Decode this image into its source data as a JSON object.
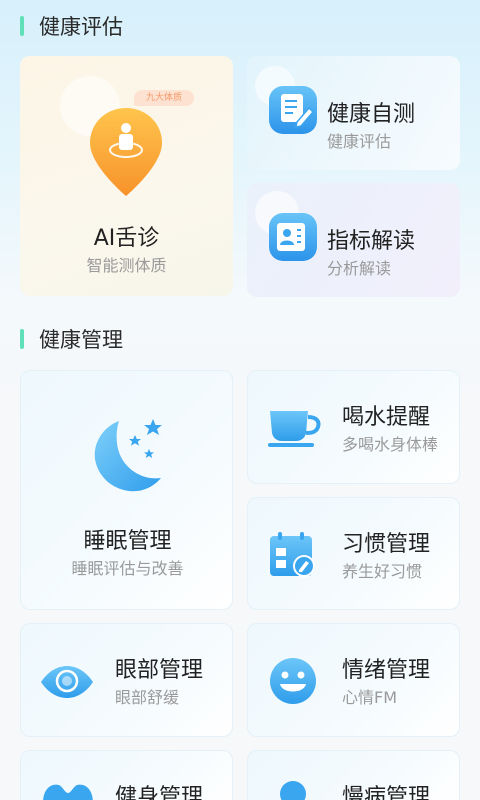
{
  "sections": {
    "assessment_title": "健康评估",
    "management_title": "健康管理"
  },
  "ai_tongue": {
    "badge": "九大体质",
    "title": "AI舌诊",
    "subtitle": "智能测体质"
  },
  "self_test": {
    "title": "健康自测",
    "subtitle": "健康评估"
  },
  "indicator": {
    "title": "指标解读",
    "subtitle": "分析解读"
  },
  "sleep": {
    "title": "睡眠管理",
    "subtitle": "睡眠评估与改善"
  },
  "water": {
    "title": "喝水提醒",
    "subtitle": "多喝水身体棒"
  },
  "habit": {
    "title": "习惯管理",
    "subtitle": "养生好习惯"
  },
  "eye": {
    "title": "眼部管理",
    "subtitle": "眼部舒缓"
  },
  "mood": {
    "title": "情绪管理",
    "subtitle": "心情FM"
  },
  "fitness": {
    "title": "健身管理"
  },
  "chronic": {
    "title": "慢病管理"
  },
  "colors": {
    "accent": "#5fe0b8",
    "icon_blue": "#3aa6ef",
    "orange": "#f7a23a"
  }
}
